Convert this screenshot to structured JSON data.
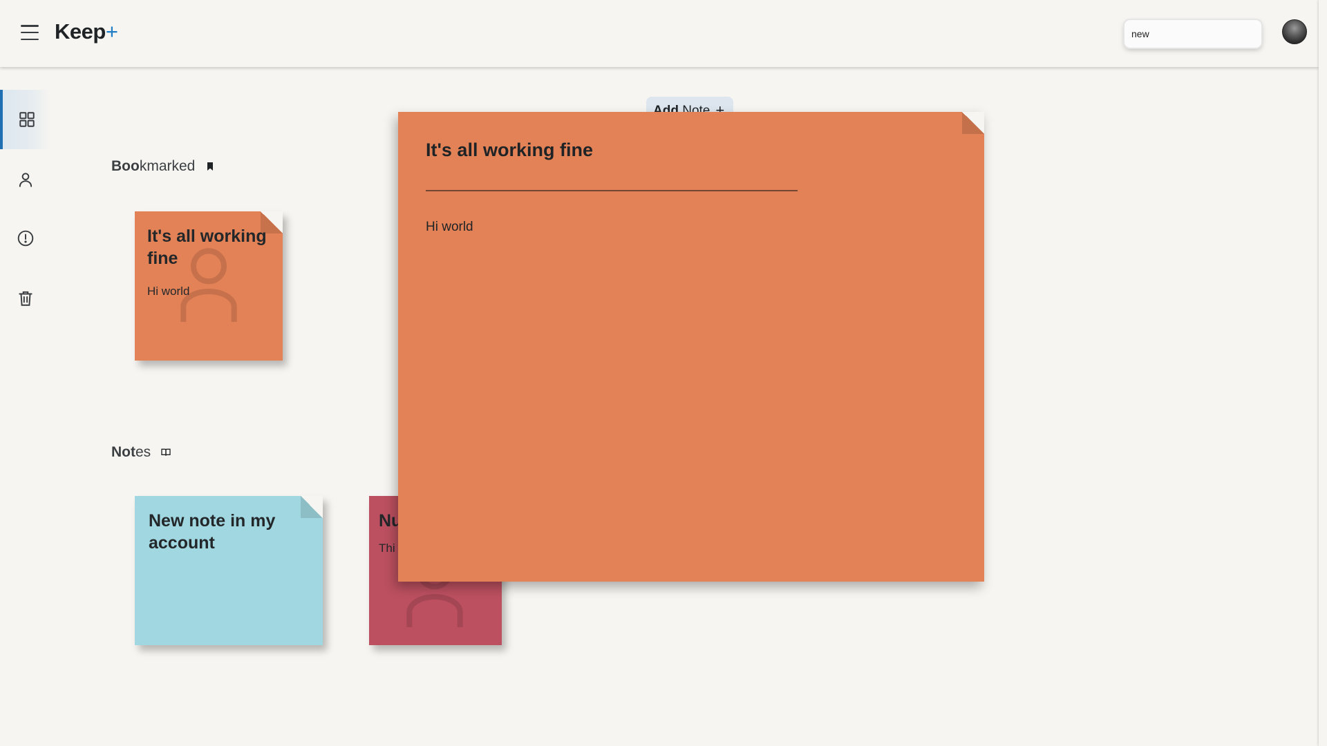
{
  "header": {
    "app_title": "Keep",
    "app_title_suffix": "+",
    "search_value": "new",
    "icons": [
      "menu-icon",
      "search-icon",
      "avatar"
    ]
  },
  "sidebar": {
    "items": [
      {
        "name": "notes-grid",
        "icon": "grid-icon",
        "active": true
      },
      {
        "name": "account",
        "icon": "person-icon",
        "active": false
      },
      {
        "name": "about",
        "icon": "info-circle-icon",
        "active": false
      },
      {
        "name": "trash",
        "icon": "trash-icon",
        "active": false
      }
    ]
  },
  "add_note": {
    "label_bold": "Add",
    "label_rest": "Note",
    "icon": "plus-icon"
  },
  "sections": {
    "bookmarked": {
      "title_bold": "Boo",
      "title_rest": "kmarked",
      "icon": "bookmark-icon"
    },
    "notes": {
      "title_bold": "Not",
      "title_rest": "es",
      "icon": "book-open-icon"
    }
  },
  "bookmarked_notes": [
    {
      "title": "It's all working fine",
      "body": "Hi world",
      "color": "#e38257"
    }
  ],
  "notes": [
    {
      "title": "New note in my account",
      "body": "",
      "color": "#a0d7e0"
    },
    {
      "title": "Nu",
      "body": "Thi",
      "color": "#bc5060"
    }
  ],
  "open_note": {
    "title": "It's all working fine",
    "body": "Hi world",
    "color": "#e38257"
  },
  "colors": {
    "background": "#f7f5f1",
    "accent": "#1f6fb2"
  }
}
